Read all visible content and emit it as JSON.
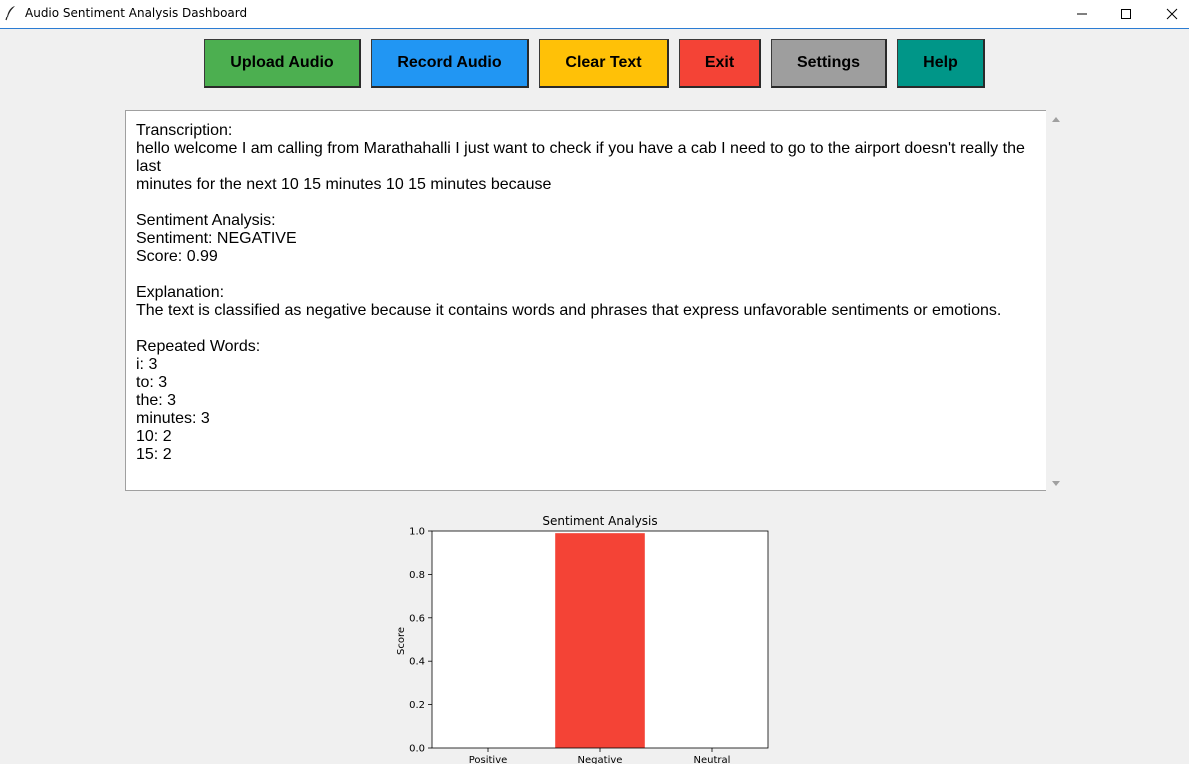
{
  "window": {
    "title": "Audio Sentiment Analysis Dashboard"
  },
  "toolbar": {
    "buttons": [
      {
        "label": "Upload Audio",
        "color": "#4caf50"
      },
      {
        "label": "Record Audio",
        "color": "#2196f3"
      },
      {
        "label": "Clear Text",
        "color": "#ffc107"
      },
      {
        "label": "Exit",
        "color": "#f44336"
      },
      {
        "label": "Settings",
        "color": "#9e9e9e"
      },
      {
        "label": "Help",
        "color": "#009688"
      }
    ]
  },
  "output": {
    "transcription_heading": "Transcription:",
    "transcription_line1": "hello welcome I am calling from Marathahalli I just want to check if you have a cab I need to go to the airport doesn't really the last",
    "transcription_line2": "minutes for the next 10 15 minutes 10 15 minutes because",
    "sentiment_heading": "Sentiment Analysis:",
    "sentiment_line": "Sentiment: NEGATIVE",
    "score_line": "Score: 0.99",
    "explanation_heading": "Explanation:",
    "explanation_text": "The text is classified as negative because it contains words and phrases that express unfavorable sentiments or emotions.",
    "repeated_heading": "Repeated Words:",
    "repeated_words": [
      "i: 3",
      "to: 3",
      "the: 3",
      "minutes: 3",
      "10: 2",
      "15: 2"
    ]
  },
  "chart_data": {
    "type": "bar",
    "title": "Sentiment Analysis",
    "xlabel": "",
    "ylabel": "Score",
    "categories": [
      "Positive",
      "Negative",
      "Neutral"
    ],
    "values": [
      0,
      0.99,
      0
    ],
    "ylim": [
      0,
      1.0
    ],
    "yticks": [
      "0.0",
      "0.2",
      "0.4",
      "0.6",
      "0.8",
      "1.0"
    ],
    "bar_color": "#f44336",
    "grid": false
  }
}
